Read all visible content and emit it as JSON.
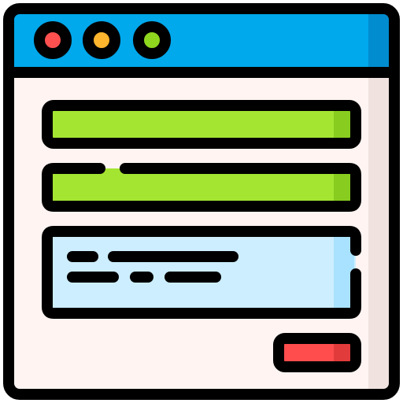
{
  "window": {
    "title_bar_color": "#00a8ec",
    "title_bar_shade": "#008ccf",
    "body_color": "#fff4f2",
    "body_shade": "#f0e3df",
    "outline_color": "#000000"
  },
  "controls": [
    {
      "name": "close-dot-icon",
      "color": "#ff5050"
    },
    {
      "name": "minimize-dot-icon",
      "color": "#ffb52e"
    },
    {
      "name": "maximize-dot-icon",
      "color": "#8fd61f"
    }
  ],
  "fields": {
    "primary_color": "#a4e532",
    "primary_shade": "#88cc1f",
    "text_area_color": "#cdeeff",
    "text_area_shade": "#a9e2ff"
  },
  "submit": {
    "color": "#ff4d4d",
    "shade": "#e23b3b"
  }
}
